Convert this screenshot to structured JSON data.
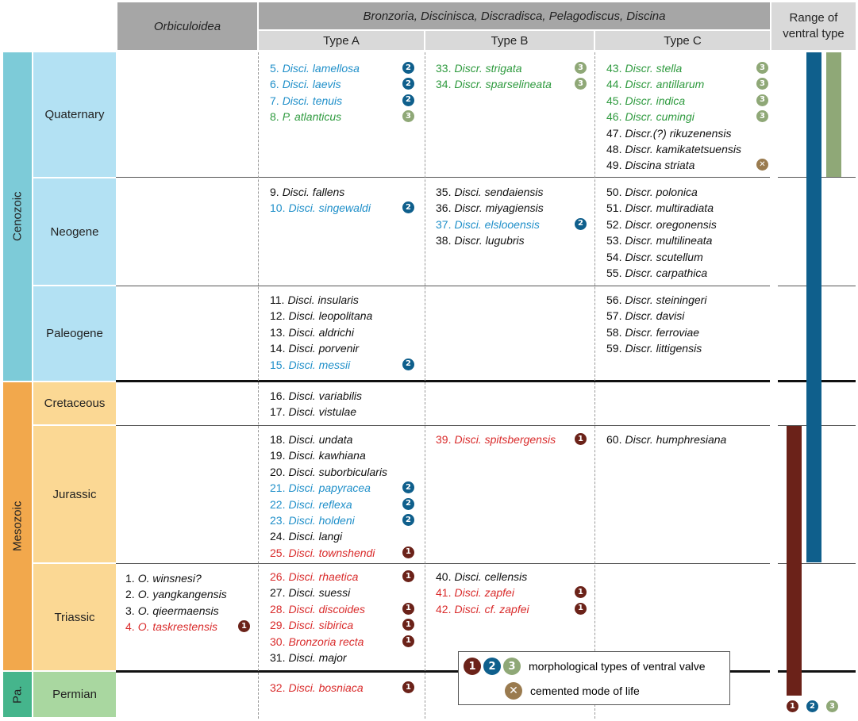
{
  "colors": {
    "black": "#111111",
    "blue": "#1f8fc9",
    "green": "#2e9a3e",
    "red": "#d92b2b",
    "type1": "#6b2219",
    "type2": "#0f5f8c",
    "type3": "#8fa877",
    "cemented": "#9a7b4f",
    "ceno_era": "#7dcbd8",
    "ceno_period": "#b3e1f3",
    "meso_era": "#f2a84c",
    "meso_period": "#fbd894",
    "paleo_era": "#45b58c",
    "paleo_period": "#a9d7a0"
  },
  "header": {
    "orbiculoidea": "Orbiculoidea",
    "group": "Bronzoria, Discinisca, Discradisca, Pelagodiscus, Discina",
    "type_a": "Type A",
    "type_b": "Type B",
    "type_c": "Type C",
    "range_line1": "Range of",
    "range_line2": "ventral type"
  },
  "eras": [
    {
      "name": "Cenozoic",
      "color_key": "ceno"
    },
    {
      "name": "Mesozoic",
      "color_key": "meso"
    },
    {
      "name": "Pa.",
      "color_key": "paleo"
    }
  ],
  "periods": [
    "Quaternary",
    "Neogene",
    "Paleogene",
    "Cretaceous",
    "Jurassic",
    "Triassic",
    "Permian"
  ],
  "species": {
    "orb": [
      {
        "num": "1.",
        "name": "O. winsnesi?",
        "color": "black",
        "badge": null
      },
      {
        "num": "2.",
        "name": "O. yangkangensis",
        "color": "black",
        "badge": null
      },
      {
        "num": "3.",
        "name": "O. qieermaensis",
        "color": "black",
        "badge": null
      },
      {
        "num": "4.",
        "name": "O. taskrestensis",
        "color": "red",
        "badge": "1"
      }
    ],
    "typeA": [
      {
        "num": "5.",
        "name": "Disci. lamellosa",
        "color": "blue",
        "badge": "2"
      },
      {
        "num": "6.",
        "name": "Disci. laevis",
        "color": "blue",
        "badge": "2"
      },
      {
        "num": "7.",
        "name": "Disci. tenuis",
        "color": "blue",
        "badge": "2"
      },
      {
        "num": "8.",
        "name": "P. atlanticus",
        "color": "green",
        "badge": "3"
      },
      {
        "num": "9.",
        "name": "Disci. fallens",
        "color": "black",
        "badge": null
      },
      {
        "num": "10.",
        "name": "Disci. singewaldi",
        "color": "blue",
        "badge": "2"
      },
      {
        "num": "11.",
        "name": "Disci. insularis",
        "color": "black",
        "badge": null
      },
      {
        "num": "12.",
        "name": "Disci. leopolitana",
        "color": "black",
        "badge": null
      },
      {
        "num": "13.",
        "name": "Disci. aldrichi",
        "color": "black",
        "badge": null
      },
      {
        "num": "14.",
        "name": "Disci. porvenir",
        "color": "black",
        "badge": null
      },
      {
        "num": "15.",
        "name": "Disci. messii",
        "color": "blue",
        "badge": "2"
      },
      {
        "num": "16.",
        "name": "Disci. variabilis",
        "color": "black",
        "badge": null
      },
      {
        "num": "17.",
        "name": "Disci. vistulae",
        "color": "black",
        "badge": null
      },
      {
        "num": "18.",
        "name": "Disci. undata",
        "color": "black",
        "badge": null
      },
      {
        "num": "19.",
        "name": "Disci. kawhiana",
        "color": "black",
        "badge": null
      },
      {
        "num": "20.",
        "name": "Disci. suborbicularis",
        "color": "black",
        "badge": null
      },
      {
        "num": "21.",
        "name": "Disci. papyracea",
        "color": "blue",
        "badge": "2"
      },
      {
        "num": "22.",
        "name": "Disci. reflexa",
        "color": "blue",
        "badge": "2"
      },
      {
        "num": "23.",
        "name": "Disci. holdeni",
        "color": "blue",
        "badge": "2"
      },
      {
        "num": "24.",
        "name": "Disci. langi",
        "color": "black",
        "badge": null
      },
      {
        "num": "25.",
        "name": "Disci. townshendi",
        "color": "red",
        "badge": "1"
      },
      {
        "num": "26.",
        "name": "Disci. rhaetica",
        "color": "red",
        "badge": "1"
      },
      {
        "num": "27.",
        "name": "Disci. suessi",
        "color": "black",
        "badge": null
      },
      {
        "num": "28.",
        "name": "Disci. discoides",
        "color": "red",
        "badge": "1"
      },
      {
        "num": "29.",
        "name": "Disci. sibirica",
        "color": "red",
        "badge": "1"
      },
      {
        "num": "30.",
        "name": "Bronzoria recta",
        "color": "red",
        "badge": "1"
      },
      {
        "num": "31.",
        "name": "Disci. major",
        "color": "black",
        "badge": null
      },
      {
        "num": "32.",
        "name": "Disci. bosniaca",
        "color": "red",
        "badge": "1"
      }
    ],
    "typeB": [
      {
        "num": "33.",
        "name": "Discr. strigata",
        "color": "green",
        "badge": "3"
      },
      {
        "num": "34.",
        "name": "Discr. sparselineata",
        "color": "green",
        "badge": "3"
      },
      {
        "num": "35.",
        "name": "Disci. sendaiensis",
        "color": "black",
        "badge": null
      },
      {
        "num": "36.",
        "name": "Discr. miyagiensis",
        "color": "black",
        "badge": null
      },
      {
        "num": "37.",
        "name": "Disci. elslooensis",
        "color": "blue",
        "badge": "2"
      },
      {
        "num": "38.",
        "name": "Discr. lugubris",
        "color": "black",
        "badge": null
      },
      {
        "num": "39.",
        "name": "Disci. spitsbergensis",
        "color": "red",
        "badge": "1"
      },
      {
        "num": "40.",
        "name": "Disci. cellensis",
        "color": "black",
        "badge": null
      },
      {
        "num": "41.",
        "name": "Disci. zapfei",
        "color": "red",
        "badge": "1"
      },
      {
        "num": "42.",
        "name": "Disci. cf. zapfei",
        "color": "red",
        "badge": "1"
      }
    ],
    "typeC": [
      {
        "num": "43.",
        "name": "Discr. stella",
        "color": "green",
        "badge": "3"
      },
      {
        "num": "44.",
        "name": "Discr. antillarum",
        "color": "green",
        "badge": "3"
      },
      {
        "num": "45.",
        "name": "Discr. indica",
        "color": "green",
        "badge": "3"
      },
      {
        "num": "46.",
        "name": "Discr. cumingi",
        "color": "green",
        "badge": "3"
      },
      {
        "num": "47.",
        "name": "Discr.(?) rikuzenensis",
        "color": "black",
        "badge": null
      },
      {
        "num": "48.",
        "name": "Discr. kamikatetsuensis",
        "color": "black",
        "badge": null
      },
      {
        "num": "49.",
        "name": "Discina striata",
        "color": "black",
        "badge": "x"
      },
      {
        "num": "50.",
        "name": "Discr. polonica",
        "color": "black",
        "badge": null
      },
      {
        "num": "51.",
        "name": "Discr. multiradiata",
        "color": "black",
        "badge": null
      },
      {
        "num": "52.",
        "name": "Discr. oregonensis",
        "color": "black",
        "badge": null
      },
      {
        "num": "53.",
        "name": "Discr. multilineata",
        "color": "black",
        "badge": null
      },
      {
        "num": "54.",
        "name": "Discr. scutellum",
        "color": "black",
        "badge": null
      },
      {
        "num": "55.",
        "name": "Discr. carpathica",
        "color": "black",
        "badge": null
      },
      {
        "num": "56.",
        "name": "Discr. steiningeri",
        "color": "black",
        "badge": null
      },
      {
        "num": "57.",
        "name": "Discr. davisi",
        "color": "black",
        "badge": null
      },
      {
        "num": "58.",
        "name": "Discr. ferroviae",
        "color": "black",
        "badge": null
      },
      {
        "num": "59.",
        "name": "Discr. littigensis",
        "color": "black",
        "badge": null
      },
      {
        "num": "60.",
        "name": "Discr. humphresiana",
        "color": "black",
        "badge": null
      }
    ]
  },
  "legend": {
    "badge1": "1",
    "badge2": "2",
    "badge3": "3",
    "types_label": "morphological types of ventral valve",
    "cemented_label": "cemented mode of life"
  },
  "range_bars": [
    {
      "type": "1",
      "from": "Permian",
      "to": "Jurassic"
    },
    {
      "type": "2",
      "from": "Jurassic",
      "to": "Quaternary"
    },
    {
      "type": "3",
      "from": "Quaternary",
      "to": "Quaternary"
    }
  ],
  "range_footer": [
    "1",
    "2",
    "3"
  ]
}
